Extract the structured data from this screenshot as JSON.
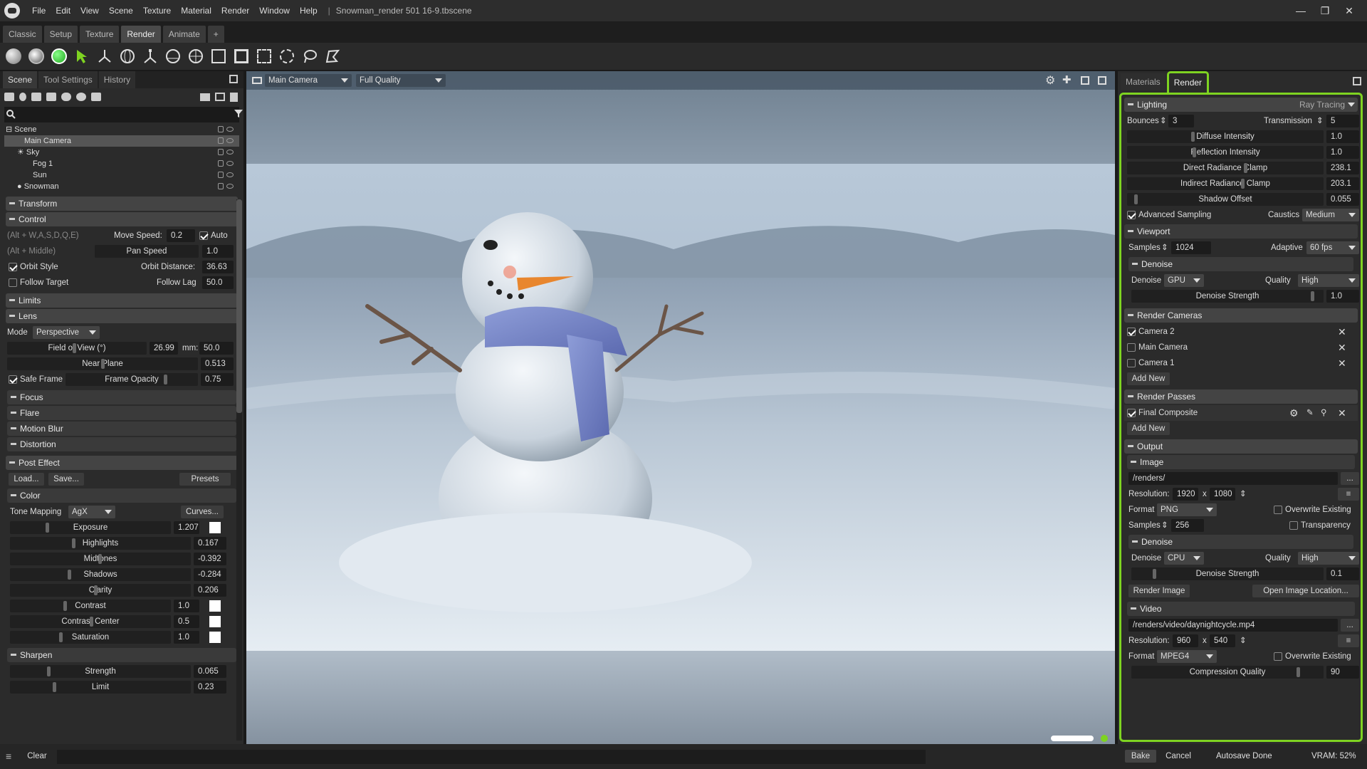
{
  "app": {
    "title": "Snowman_render 501 16-9.tbscene",
    "menu": [
      "File",
      "Edit",
      "View",
      "Scene",
      "Texture",
      "Material",
      "Render",
      "Window",
      "Help"
    ]
  },
  "workspace_tabs": [
    "Classic",
    "Setup",
    "Texture",
    "Render",
    "Animate",
    "+"
  ],
  "left": {
    "tabs": [
      "Scene",
      "Tool Settings",
      "History"
    ],
    "tree": [
      {
        "label": "Scene",
        "indent": 0
      },
      {
        "label": "Main Camera",
        "indent": 1,
        "selected": true
      },
      {
        "label": "Sky",
        "indent": 1
      },
      {
        "label": "Fog 1",
        "indent": 2
      },
      {
        "label": "Sun",
        "indent": 2
      },
      {
        "label": "Snowman",
        "indent": 1
      }
    ],
    "transform": "Transform",
    "control": {
      "title": "Control",
      "hint1": "(Alt + W,A,S,D,Q,E)",
      "move_speed_label": "Move Speed:",
      "move_speed": "0.2",
      "auto": "Auto",
      "hint2": "(Alt + Middle)",
      "pan_speed_label": "Pan Speed",
      "pan_speed": "1.0",
      "orbit_style": "Orbit Style",
      "orbit_distance_label": "Orbit Distance:",
      "orbit_distance": "36.63",
      "follow_target": "Follow Target",
      "follow_lag_label": "Follow Lag",
      "follow_lag": "50.0"
    },
    "limits": "Limits",
    "lens": {
      "title": "Lens",
      "mode_label": "Mode",
      "mode": "Perspective",
      "fov_label": "Field of View (°)",
      "fov": "26.99",
      "mm_label": "mm:",
      "mm": "50.0",
      "near_label": "Near Plane",
      "near": "0.513",
      "safe_frame": "Safe Frame",
      "frame_opacity_label": "Frame Opacity",
      "frame_opacity": "0.75"
    },
    "collapsed": [
      "Focus",
      "Flare",
      "Motion Blur",
      "Distortion"
    ],
    "post": {
      "title": "Post Effect",
      "load": "Load...",
      "save": "Save...",
      "presets": "Presets"
    },
    "color": {
      "title": "Color",
      "tone_label": "Tone Mapping",
      "tone": "AgX",
      "curves": "Curves...",
      "rows": [
        {
          "label": "Exposure",
          "value": "1.207",
          "swatch": true
        },
        {
          "label": "Highlights",
          "value": "0.167"
        },
        {
          "label": "Midtones",
          "value": "-0.392"
        },
        {
          "label": "Shadows",
          "value": "-0.284"
        },
        {
          "label": "Clarity",
          "value": "0.206"
        },
        {
          "label": "Contrast",
          "value": "1.0",
          "swatch": true
        },
        {
          "label": "Contrast Center",
          "value": "0.5",
          "swatch": true
        },
        {
          "label": "Saturation",
          "value": "1.0",
          "swatch": true
        }
      ]
    },
    "sharpen": {
      "title": "Sharpen",
      "strength_label": "Strength",
      "strength": "0.065",
      "limit_label": "Limit",
      "limit": "0.23"
    }
  },
  "viewport": {
    "camera": "Main Camera",
    "quality": "Full Quality"
  },
  "right": {
    "tabs": [
      "Materials",
      "Render"
    ],
    "lighting": {
      "title": "Lighting",
      "mode": "Ray Tracing",
      "bounces_label": "Bounces",
      "bounces": "3",
      "transmission_label": "Transmission",
      "transmission": "5",
      "sliders": [
        {
          "label": "Diffuse Intensity",
          "value": "1.0"
        },
        {
          "label": "Reflection Intensity",
          "value": "1.0"
        },
        {
          "label": "Direct Radiance Clamp",
          "value": "238.1"
        },
        {
          "label": "Indirect Radiance Clamp",
          "value": "203.1"
        },
        {
          "label": "Shadow Offset",
          "value": "0.055"
        }
      ],
      "advanced": "Advanced Sampling",
      "caustics_label": "Caustics",
      "caustics": "Medium"
    },
    "viewport": {
      "title": "Viewport",
      "samples_label": "Samples",
      "samples": "1024",
      "adaptive_label": "Adaptive",
      "adaptive": "60 fps",
      "denoise_title": "Denoise",
      "denoise_label": "Denoise",
      "denoise": "GPU",
      "quality_label": "Quality",
      "quality": "High",
      "strength_label": "Denoise Strength",
      "strength": "1.0"
    },
    "cameras": {
      "title": "Render Cameras",
      "items": [
        "Camera 2",
        "Main Camera",
        "Camera 1"
      ],
      "add": "Add New"
    },
    "passes": {
      "title": "Render Passes",
      "items": [
        "Final Composite"
      ],
      "add": "Add New"
    },
    "output": {
      "title": "Output",
      "image": {
        "title": "Image",
        "path": "/renders/",
        "res_label": "Resolution:",
        "w": "1920",
        "x": "x",
        "h": "1080",
        "format_label": "Format",
        "format": "PNG",
        "overwrite": "Overwrite Existing",
        "samples_label": "Samples",
        "samples": "256",
        "transparency": "Transparency",
        "denoise_title": "Denoise",
        "denoise_label": "Denoise",
        "denoise": "CPU",
        "quality_label": "Quality",
        "quality": "High",
        "strength_label": "Denoise Strength",
        "strength": "0.1",
        "render_btn": "Render Image",
        "open_btn": "Open Image Location..."
      },
      "video": {
        "title": "Video",
        "path": "/renders/video/daynightcycle.mp4",
        "res_label": "Resolution:",
        "w": "960",
        "x": "x",
        "h": "540",
        "format_label": "Format",
        "format": "MPEG4",
        "overwrite": "Overwrite Existing",
        "cq_label": "Compression Quality",
        "cq": "90"
      }
    }
  },
  "status": {
    "clear": "Clear",
    "bake": "Bake",
    "cancel": "Cancel",
    "autosave": "Autosave Done",
    "vram": "VRAM: 52%"
  },
  "colors": {
    "accent": "#7ed321"
  }
}
